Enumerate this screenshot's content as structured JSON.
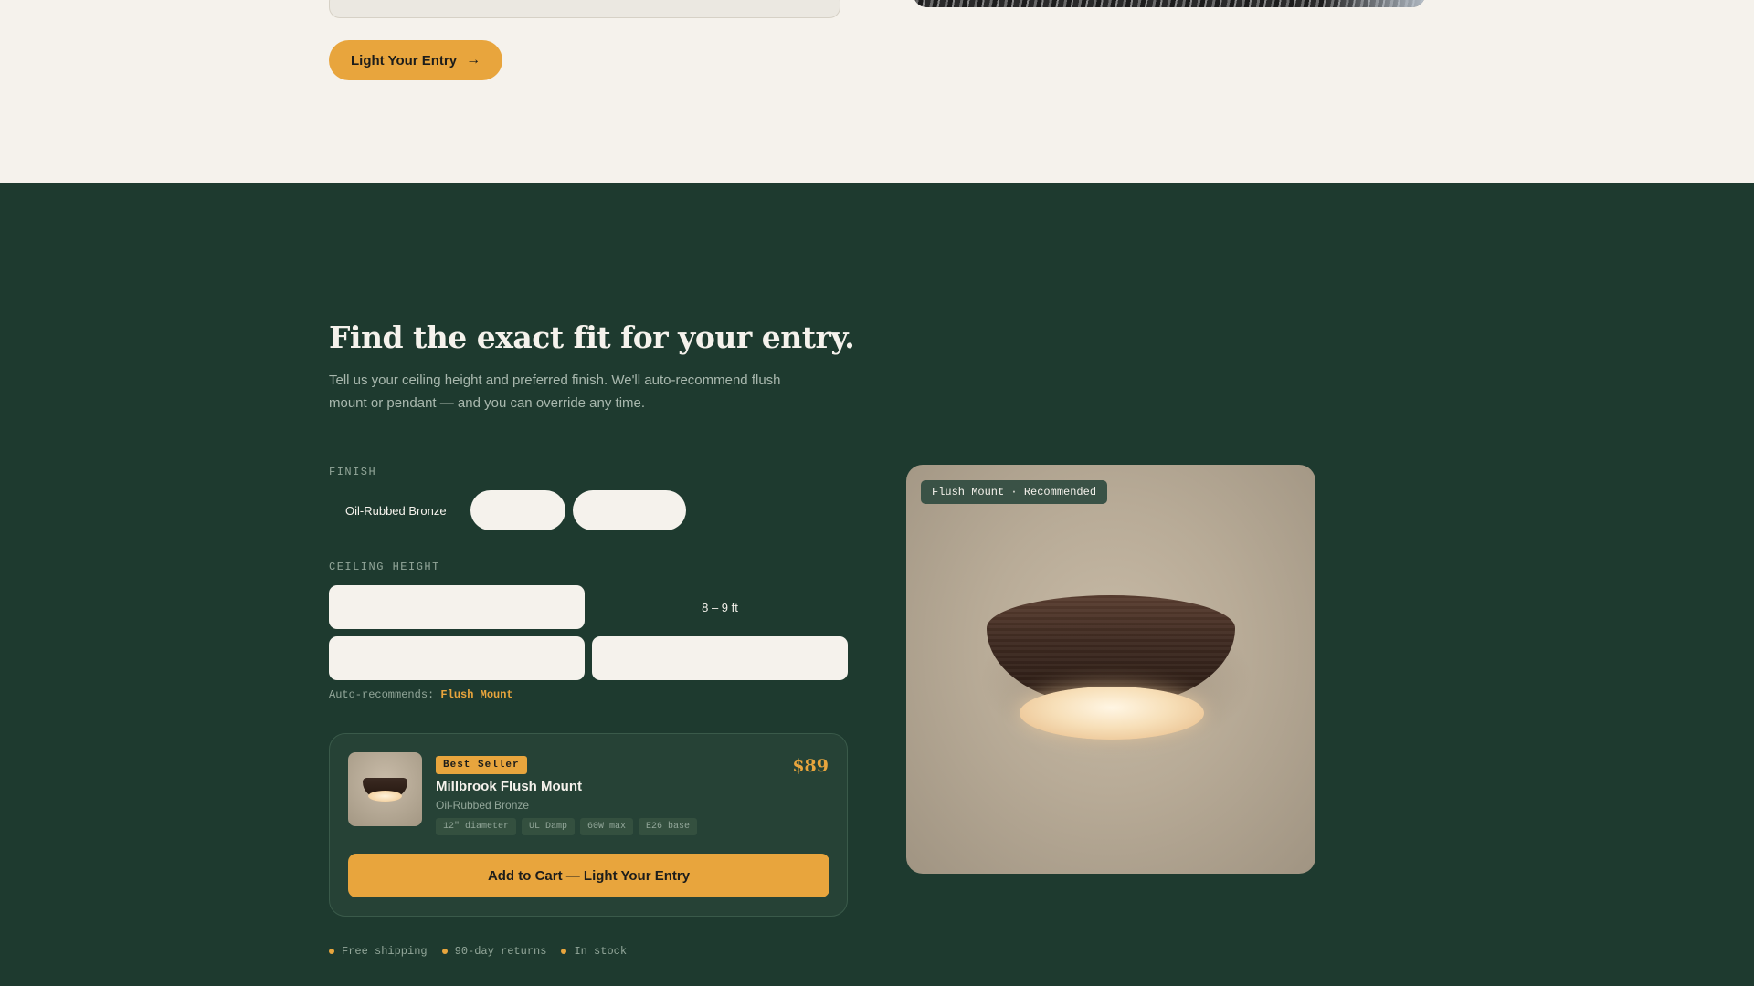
{
  "top": {
    "cta_label": "Light Your Entry"
  },
  "fit": {
    "headline": "Find the exact fit for your entry.",
    "subhead": "Tell us your ceiling height and preferred finish. We'll auto-recommend flush mount or pendant — and you can override any time.",
    "finish_label": "FINISH",
    "finishes": [
      "Oil-Rubbed Bronze",
      "",
      ""
    ],
    "height_label": "CEILING HEIGHT",
    "heights": [
      "",
      "8 – 9 ft",
      "",
      ""
    ],
    "autorec_prefix": "Auto-recommends:",
    "autorec_value": "Flush Mount"
  },
  "product": {
    "badge": "Best Seller",
    "name": "Millbrook Flush Mount",
    "finish": "Oil-Rubbed Bronze",
    "specs": [
      "12\" diameter",
      "UL Damp",
      "60W max",
      "E26 base"
    ],
    "price": "$89",
    "add_label": "Add to Cart — Light Your Entry"
  },
  "perks": [
    "Free shipping",
    "90-day returns",
    "In stock"
  ],
  "preview": {
    "label": "Flush Mount · Recommended"
  },
  "colors": {
    "accent": "#e8a53d",
    "forest": "#1e3a2f",
    "cream": "#f5f2ec"
  }
}
